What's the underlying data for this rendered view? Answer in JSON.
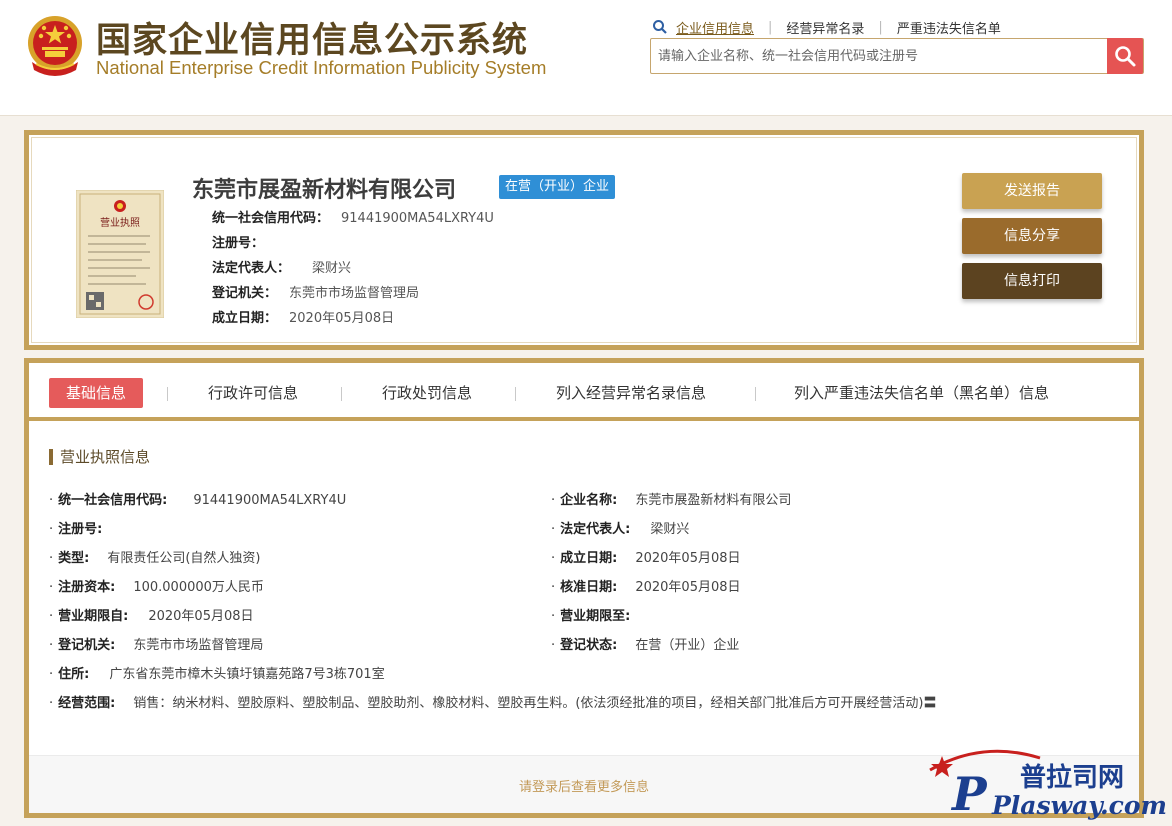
{
  "header": {
    "title_cn": "国家企业信用信息公示系统",
    "title_en": "National Enterprise Credit Information Publicity System",
    "nav": [
      "企业信用信息",
      "经营异常名录",
      "严重违法失信名单"
    ],
    "search_placeholder": "请输入企业名称、统一社会信用代码或注册号"
  },
  "company": {
    "name": "东莞市展盈新材料有限公司",
    "status_badge": "在营（开业）企业",
    "fields": [
      {
        "label": "统一社会信用代码：",
        "value": "91441900MA54LXRY4U"
      },
      {
        "label": "注册号：",
        "value": ""
      },
      {
        "label": "法定代表人：",
        "value": "梁财兴"
      },
      {
        "label": "登记机关：",
        "value": "东莞市市场监督管理局"
      },
      {
        "label": "成立日期：",
        "value": "2020年05月08日"
      }
    ],
    "license_title": "营业执照",
    "actions": [
      "发送报告",
      "信息分享",
      "信息打印"
    ]
  },
  "tabs": [
    "基础信息",
    "行政许可信息",
    "行政处罚信息",
    "列入经营异常名录信息",
    "列入严重违法失信名单（黑名单）信息"
  ],
  "detail": {
    "section_title": "营业执照信息",
    "left": [
      {
        "label": "统一社会信用代码:",
        "value": "91441900MA54LXRY4U"
      },
      {
        "label": "注册号:",
        "value": ""
      },
      {
        "label": "类型:",
        "value": "有限责任公司(自然人独资)"
      },
      {
        "label": "注册资本:",
        "value": "100.000000万人民币"
      },
      {
        "label": "营业期限自:",
        "value": "2020年05月08日"
      },
      {
        "label": "登记机关:",
        "value": "东莞市市场监督管理局"
      },
      {
        "label": "住所:",
        "value": "广东省东莞市樟木头镇圩镇嘉苑路7号3栋701室"
      },
      {
        "label": "经营范围:",
        "value": "销售：纳米材料、塑胶原料、塑胶制品、塑胶助剂、橡胶材料、塑胶再生料。(依法须经批准的项目，经相关部门批准后方可开展经营活动)〓"
      }
    ],
    "right": [
      {
        "label": "企业名称:",
        "value": "东莞市展盈新材料有限公司"
      },
      {
        "label": "法定代表人:",
        "value": "梁财兴"
      },
      {
        "label": "成立日期:",
        "value": "2020年05月08日"
      },
      {
        "label": "核准日期:",
        "value": "2020年05月08日"
      },
      {
        "label": "营业期限至:",
        "value": ""
      },
      {
        "label": "登记状态:",
        "value": "在营（开业）企业"
      }
    ],
    "login_more": "请登录后查看更多信息"
  },
  "watermark": {
    "cn": "普拉司网",
    "en": "Plasway.com"
  },
  "colors": {
    "gold_border": "#c5a25a",
    "title_brown": "#5c4720",
    "title_gold": "#a57d28",
    "badge_blue": "#2f8fd6",
    "tab_active_red": "#e55b5b",
    "search_btn_red": "#e55453",
    "btn_send": "#c9a252",
    "btn_share": "#9a6b2c",
    "btn_print": "#5c4320"
  }
}
